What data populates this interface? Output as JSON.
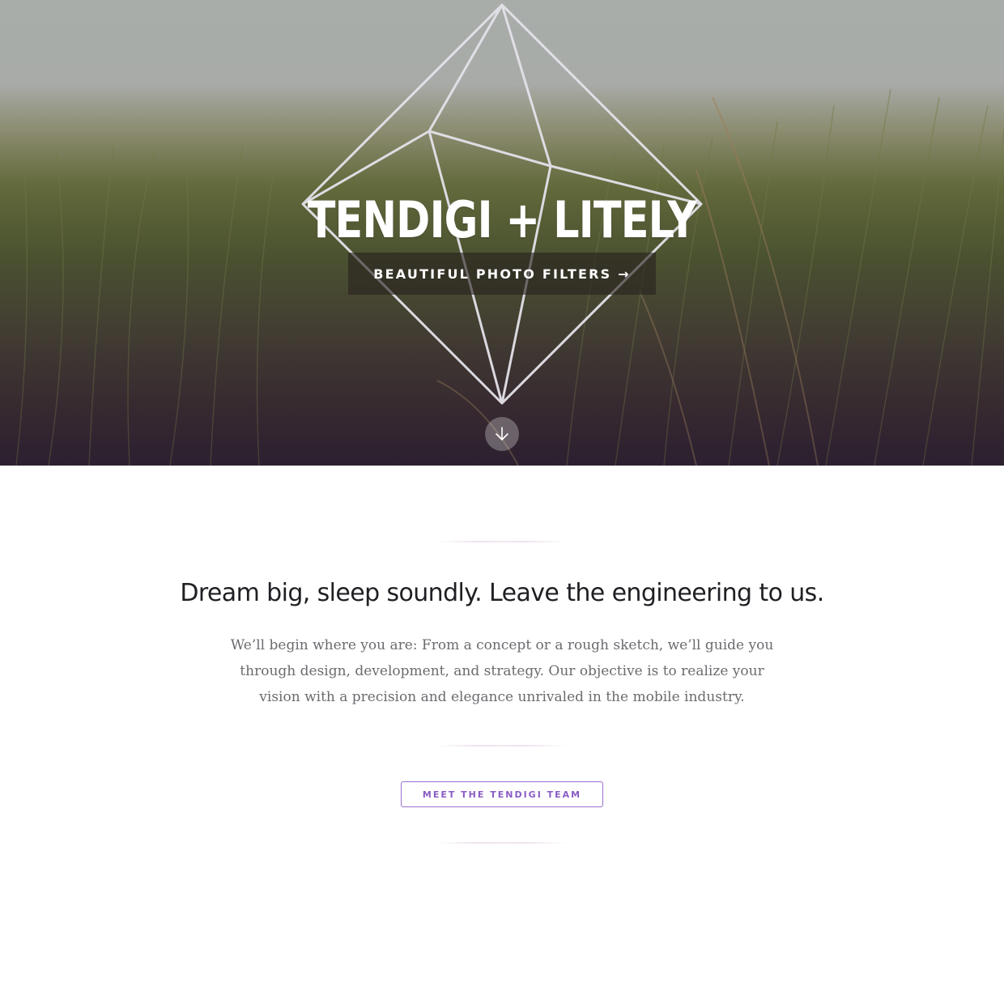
{
  "hero": {
    "title": "TENDIGI + LITELY",
    "cta_label": "BEAUTIFUL PHOTO FILTERS →",
    "scroll_icon": "arrow-down-icon",
    "logo_icon": "crystal-outline-icon"
  },
  "intro": {
    "headline": "Dream big, sleep soundly. Leave the engineering to us.",
    "body": "We’ll begin where you are: From a concept or a rough sketch, we’ll guide you through design, development, and strategy. Our objective is to realize your vision with a precision and elegance unrivaled in the mobile industry.",
    "button_label": "MEET THE TENDIGI TEAM"
  },
  "colors": {
    "accent": "#8a5cc6",
    "headline": "#1f1f24",
    "body": "#6c6a6f",
    "divider": "#efe3ef"
  }
}
